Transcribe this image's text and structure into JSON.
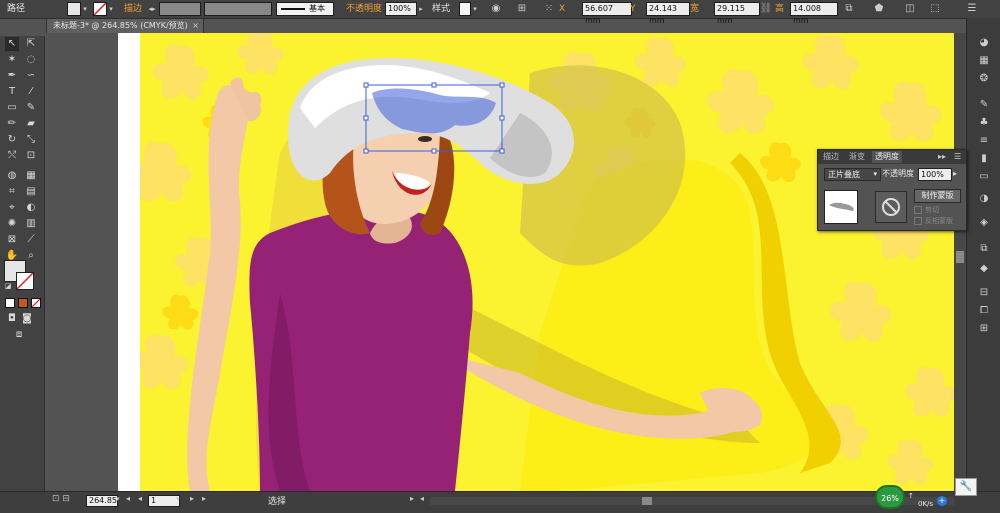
{
  "controlbar": {
    "object_type": "路径",
    "stroke_label": "描边",
    "stroke_weight": "",
    "profile_label": "基本",
    "opacity_label": "不透明度",
    "opacity_value": "100%",
    "style_label": "样式",
    "x_label": "X",
    "x_value": "56.607 mm",
    "y_label": "Y",
    "y_value": "24.143 mm",
    "w_label": "宽",
    "w_value": "29.115 mm",
    "h_label": "高",
    "h_value": "14.008 mm"
  },
  "document": {
    "tab_title": "未标题-3* @ 264.85% (CMYK/预览)",
    "close_glyph": "×"
  },
  "tools": {
    "fill_color": "#e6e6e6",
    "icons": [
      "selection-icon",
      "direct-selection-icon",
      "magic-wand-icon",
      "lasso-icon",
      "pen-icon",
      "curvature-icon",
      "type-icon",
      "line-icon",
      "rectangle-icon",
      "paintbrush-icon",
      "pencil-icon",
      "eraser-icon",
      "rotate-icon",
      "scale-icon",
      "width-icon",
      "free-transform-icon",
      "shape-builder-icon",
      "perspective-icon",
      "mesh-icon",
      "gradient-icon",
      "eyedropper-icon",
      "blend-icon",
      "symbol-sprayer-icon",
      "column-graph-icon",
      "artboard-icon",
      "slice-icon",
      "hand-icon",
      "zoom-icon"
    ]
  },
  "transparency_panel": {
    "tabs": [
      "描边",
      "渐变",
      "透明度"
    ],
    "active_tab": "透明度",
    "blend_mode": "正片叠底",
    "opacity_label": "不透明度",
    "opacity_value": "100%",
    "make_mask_button": "制作蒙版",
    "clip_label": "剪切",
    "invert_mask_label": "反相蒙版"
  },
  "statusbar": {
    "zoom": "264.85",
    "artboard": "1",
    "tool_status": "选择"
  },
  "system": {
    "percent": "26%",
    "speed": "0K/s"
  },
  "colors": {
    "background_yellow": "#fbf230",
    "pattern_yellow": "#fddb15",
    "shirt": "#962276",
    "hat": "#dfdfdf",
    "hair": "#b5541a",
    "skin": "#f2c8a6",
    "selection": "#3a5fd8"
  }
}
